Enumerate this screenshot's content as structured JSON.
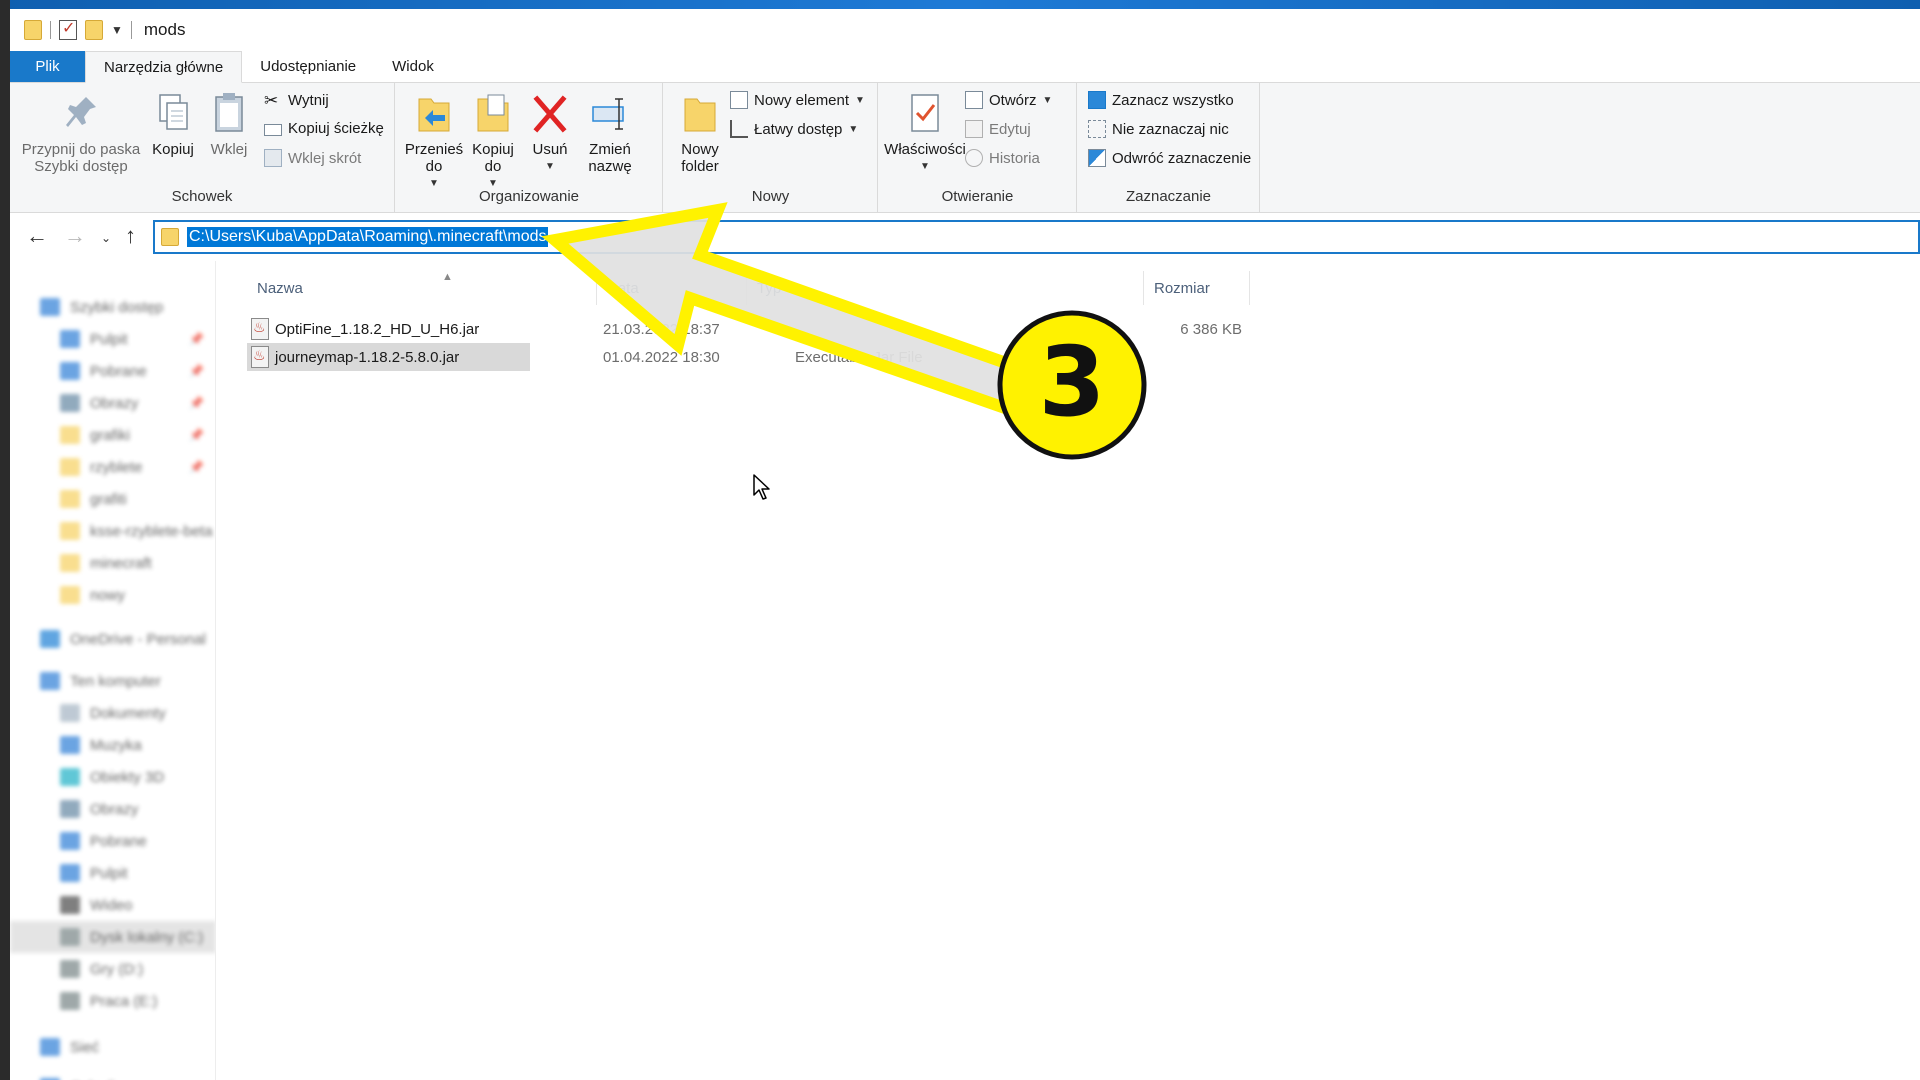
{
  "window": {
    "title": "mods"
  },
  "tabs": [
    {
      "label": "Plik"
    },
    {
      "label": "Narzędzia główne"
    },
    {
      "label": "Udostępnianie"
    },
    {
      "label": "Widok"
    }
  ],
  "ribbon": {
    "schowek": {
      "label": "Schowek",
      "pin": "Przypnij do paska Szybki dostęp",
      "copy": "Kopiuj",
      "paste": "Wklej",
      "cut": "Wytnij",
      "copy_path": "Kopiuj ścieżkę",
      "paste_shortcut": "Wklej skrót"
    },
    "organizowanie": {
      "label": "Organizowanie",
      "move_to": "Przenieś do",
      "copy_to": "Kopiuj do",
      "delete": "Usuń",
      "rename": "Zmień nazwę"
    },
    "nowy": {
      "label": "Nowy",
      "new_folder": "Nowy folder",
      "new_item": "Nowy element",
      "easy_access": "Łatwy dostęp"
    },
    "otwieranie": {
      "label": "Otwieranie",
      "properties": "Właściwości",
      "open": "Otwórz",
      "edit": "Edytuj",
      "history": "Historia"
    },
    "zaznaczanie": {
      "label": "Zaznaczanie",
      "select_all": "Zaznacz wszystko",
      "select_none": "Nie zaznaczaj nic",
      "invert": "Odwróć zaznaczenie"
    }
  },
  "address": {
    "path": "C:\\Users\\Kuba\\AppData\\Roaming\\.minecraft\\mods"
  },
  "sidebar": {
    "items": [
      {
        "label": "Szybki dostęp",
        "icon": "star-icon",
        "color": "#3a86d9"
      },
      {
        "label": "Pulpit",
        "icon": "desktop-icon",
        "color": "#3a86d9"
      },
      {
        "label": "Pobrane",
        "icon": "download-icon",
        "color": "#3a86d9"
      },
      {
        "label": "Obrazy",
        "icon": "pictures-icon",
        "color": "#6d8ea8"
      },
      {
        "label": "grafiki",
        "icon": "folder-icon",
        "color": "#f7d46a"
      },
      {
        "label": "rzyblete",
        "icon": "folder-icon",
        "color": "#f7d46a"
      },
      {
        "label": "grafiti",
        "icon": "folder-icon",
        "color": "#f7d46a"
      },
      {
        "label": "ksse-rzyblete-beta",
        "icon": "folder-icon",
        "color": "#f7d46a"
      },
      {
        "label": "minecraft",
        "icon": "folder-icon",
        "color": "#f7d46a"
      },
      {
        "label": "nowy",
        "icon": "folder-icon",
        "color": "#f7d46a"
      },
      {
        "label": "OneDrive - Personal",
        "icon": "cloud-icon",
        "color": "#2b88d8"
      },
      {
        "label": "Ten komputer",
        "icon": "computer-icon",
        "color": "#3a86d9"
      },
      {
        "label": "Dokumenty",
        "icon": "documents-icon",
        "color": "#a9b8c6"
      },
      {
        "label": "Muzyka",
        "icon": "music-icon",
        "color": "#3a86d9"
      },
      {
        "label": "Obiekty 3D",
        "icon": "cube-icon",
        "color": "#2bb5c9"
      },
      {
        "label": "Obrazy",
        "icon": "pictures-icon",
        "color": "#6d8ea8"
      },
      {
        "label": "Pobrane",
        "icon": "download-icon",
        "color": "#3a86d9"
      },
      {
        "label": "Pulpit",
        "icon": "desktop-icon",
        "color": "#3a86d9"
      },
      {
        "label": "Wideo",
        "icon": "video-icon",
        "color": "#555555"
      },
      {
        "label": "Dysk lokalny (C:)",
        "icon": "drive-icon",
        "color": "#7f8c8d"
      },
      {
        "label": "Gry (D:)",
        "icon": "drive-icon",
        "color": "#7f8c8d"
      },
      {
        "label": "Praca (E:)",
        "icon": "drive-icon",
        "color": "#7f8c8d"
      },
      {
        "label": "Sieć",
        "icon": "network-icon",
        "color": "#3a86d9"
      },
      {
        "label": "Calculi",
        "icon": "network-icon",
        "color": "#3a86d9"
      }
    ]
  },
  "columns": {
    "name": "Nazwa",
    "date": "Data",
    "type": "Typ",
    "size": "Rozmiar"
  },
  "files": [
    {
      "name": "OptiFine_1.18.2_HD_U_H6.jar",
      "date": "21.03.2022 18:37",
      "type": "",
      "size": "6 386 KB"
    },
    {
      "name": "journeymap-1.18.2-5.8.0.jar",
      "date": "01.04.2022 18:30",
      "type": "Executable Jar File",
      "size": ""
    }
  ],
  "annotation": {
    "number": "3",
    "arrow_color": "#fff200",
    "badge_color": "#fff200"
  }
}
